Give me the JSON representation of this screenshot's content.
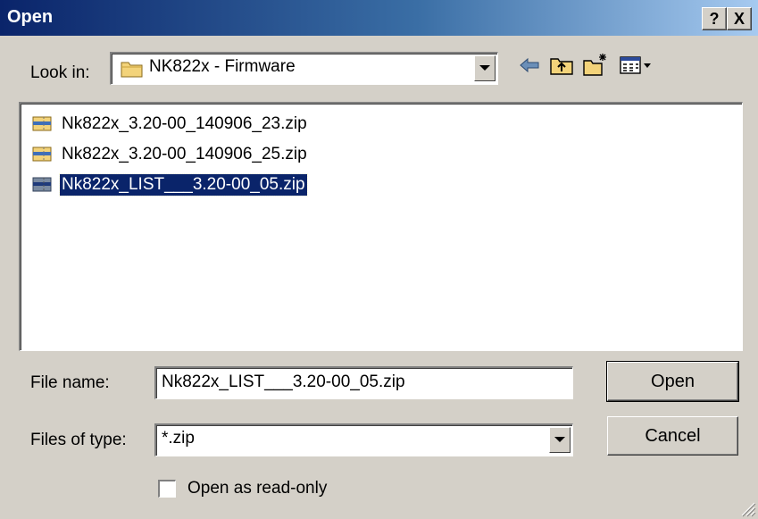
{
  "window": {
    "title": "Open"
  },
  "title_buttons": {
    "help": "?",
    "close": "X"
  },
  "look_in": {
    "label": "Look in:",
    "value": "NK822x - Firmware"
  },
  "toolbar_icons": [
    "back-arrow-icon",
    "up-folder-icon",
    "new-folder-icon",
    "view-menu-icon"
  ],
  "files": [
    {
      "name": "Nk822x_3.20-00_140906_23.zip",
      "selected": false
    },
    {
      "name": "Nk822x_3.20-00_140906_25.zip",
      "selected": false
    },
    {
      "name": "Nk822x_LIST___3.20-00_05.zip",
      "selected": true
    }
  ],
  "file_name": {
    "label": "File name:",
    "value": "Nk822x_LIST___3.20-00_05.zip"
  },
  "file_type": {
    "label": "Files of type:",
    "value": "*.zip"
  },
  "read_only": {
    "label": "Open as read-only",
    "checked": false
  },
  "buttons": {
    "open": "Open",
    "cancel": "Cancel"
  },
  "colors": {
    "title_start": "#0a246a",
    "title_end": "#a6caf0",
    "selection": "#0a246a",
    "face": "#d4d0c8"
  }
}
